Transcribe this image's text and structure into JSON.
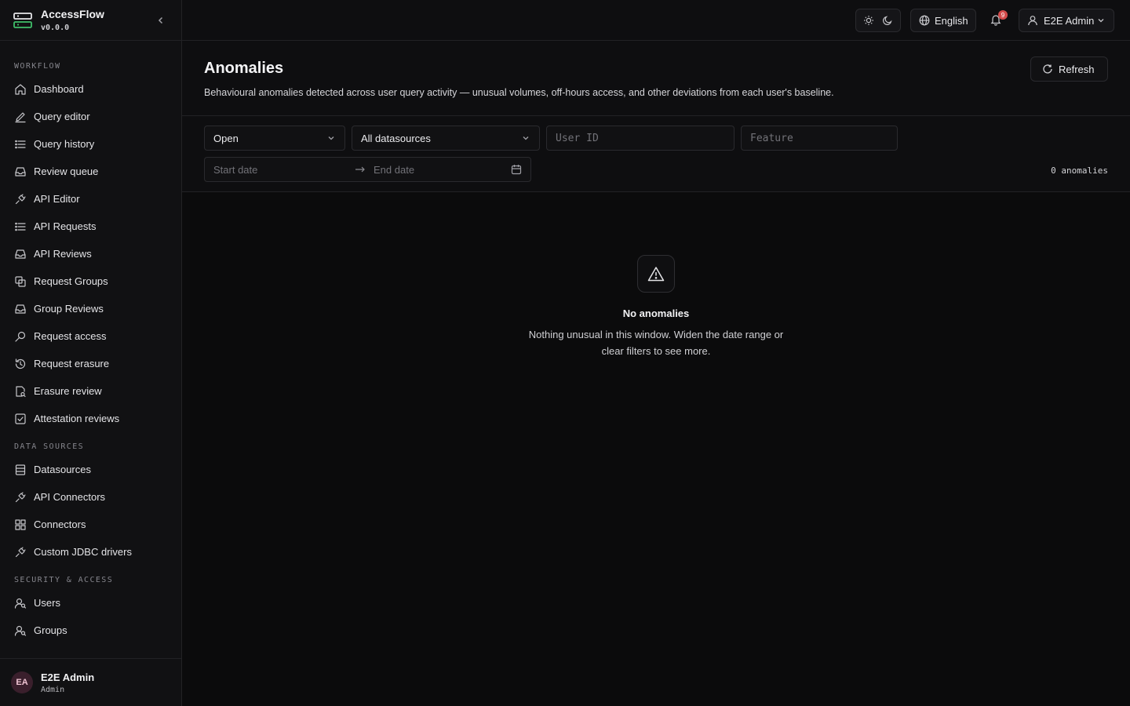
{
  "app": {
    "name": "AccessFlow",
    "version": "v0.0.0"
  },
  "sidebar": {
    "sections": [
      {
        "title": "WORKFLOW",
        "items": [
          {
            "label": "Dashboard",
            "icon": "home-icon"
          },
          {
            "label": "Query editor",
            "icon": "pencil-icon"
          },
          {
            "label": "Query history",
            "icon": "list-icon"
          },
          {
            "label": "Review queue",
            "icon": "inbox-icon"
          },
          {
            "label": "API Editor",
            "icon": "plug-icon"
          },
          {
            "label": "API Requests",
            "icon": "list-icon"
          },
          {
            "label": "API Reviews",
            "icon": "inbox-icon"
          },
          {
            "label": "Request Groups",
            "icon": "copy-icon"
          },
          {
            "label": "Group Reviews",
            "icon": "inbox-icon"
          },
          {
            "label": "Request access",
            "icon": "search-icon"
          },
          {
            "label": "Request erasure",
            "icon": "history-icon"
          },
          {
            "label": "Erasure review",
            "icon": "file-search-icon"
          },
          {
            "label": "Attestation reviews",
            "icon": "check-square-icon"
          }
        ]
      },
      {
        "title": "DATA SOURCES",
        "items": [
          {
            "label": "Datasources",
            "icon": "database-icon"
          },
          {
            "label": "API Connectors",
            "icon": "plug-icon"
          },
          {
            "label": "Connectors",
            "icon": "grid-icon"
          },
          {
            "label": "Custom JDBC drivers",
            "icon": "plug-icon"
          }
        ]
      },
      {
        "title": "SECURITY & ACCESS",
        "items": [
          {
            "label": "Users",
            "icon": "user-search-icon"
          },
          {
            "label": "Groups",
            "icon": "user-search-icon"
          }
        ]
      }
    ],
    "footer": {
      "initials": "EA",
      "name": "E2E Admin",
      "role": "Admin"
    }
  },
  "topbar": {
    "language": "English",
    "notification_count": "9",
    "user": "E2E Admin"
  },
  "page": {
    "title": "Anomalies",
    "description": "Behavioural anomalies detected across user query activity — unusual volumes, off-hours access, and other deviations from each user's baseline.",
    "refresh_label": "Refresh"
  },
  "filters": {
    "status": "Open",
    "datasource": "All datasources",
    "user_id_placeholder": "User ID",
    "feature_placeholder": "Feature",
    "start_date_placeholder": "Start date",
    "end_date_placeholder": "End date",
    "count_text": "0 anomalies"
  },
  "empty_state": {
    "title": "No anomalies",
    "text": "Nothing unusual in this window. Widen the date range or clear filters to see more."
  },
  "colors": {
    "background": "#0b0b0c",
    "badge": "#d24b4b",
    "avatar_bg": "#3a1f2c"
  }
}
